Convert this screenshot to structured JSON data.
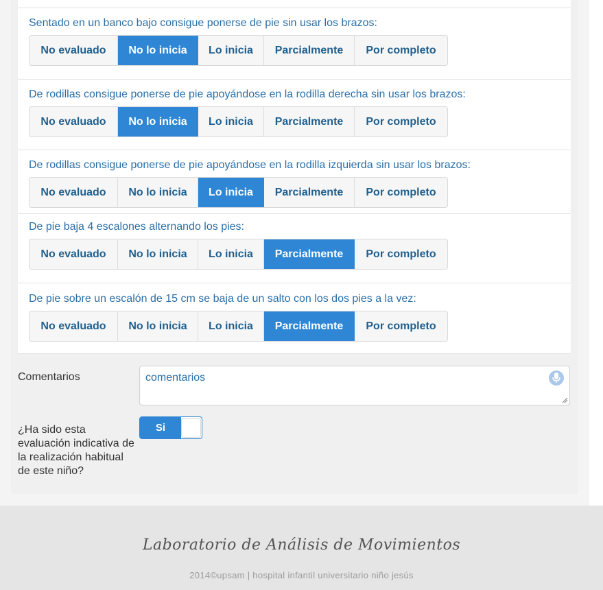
{
  "questions": [
    {
      "label": "Sentado en un banco bajo consigue ponerse de pie sin usar los brazos:",
      "options": [
        "No evaluado",
        "No lo inicia",
        "Lo inicia",
        "Parcialmente",
        "Por completo"
      ],
      "selected": "No lo inicia"
    },
    {
      "label": "De rodillas consigue ponerse de pie apoyándose en la rodilla derecha sin usar los brazos:",
      "options": [
        "No evaluado",
        "No lo inicia",
        "Lo inicia",
        "Parcialmente",
        "Por completo"
      ],
      "selected": "No lo inicia"
    },
    {
      "label": "De rodillas consigue ponerse de pie apoyándose en la rodilla izquierda sin usar los brazos:",
      "options": [
        "No evaluado",
        "No lo inicia",
        "Lo inicia",
        "Parcialmente",
        "Por completo"
      ],
      "selected": "Lo inicia"
    },
    {
      "label": "De pie baja 4 escalones alternando los pies:",
      "options": [
        "No evaluado",
        "No lo inicia",
        "Lo inicia",
        "Parcialmente",
        "Por completo"
      ],
      "selected": "Parcialmente"
    },
    {
      "label": "De pie sobre un escalón de 15 cm se baja de un salto con los dos pies a la vez:",
      "options": [
        "No evaluado",
        "No lo inicia",
        "Lo inicia",
        "Parcialmente",
        "Por completo"
      ],
      "selected": "Parcialmente"
    }
  ],
  "comments": {
    "label": "Comentarios",
    "placeholder": "comentarios",
    "mic_icon": "microphone-icon"
  },
  "indicative": {
    "label": "¿Ha sido esta evaluación indicativa de la realización habitual de este niño?",
    "toggle_text": "Si",
    "value": true
  },
  "footer": {
    "title": "Laboratorio de Análisis de Movimientos",
    "copyright": "2014©upsam | hospital infantil universitario niño jesús"
  },
  "colors": {
    "accent": "#2e86d4",
    "label_text": "#2a6fa8"
  }
}
